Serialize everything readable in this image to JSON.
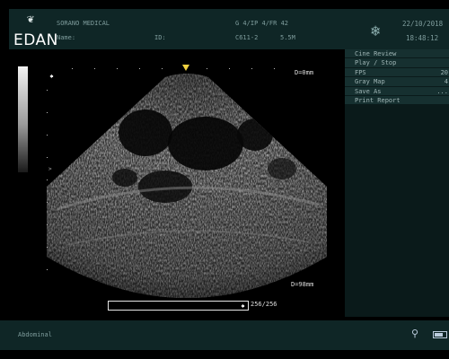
{
  "header": {
    "logo_text": "EDAN",
    "hospital": "SORANO MEDICAL",
    "name_label": "Name:",
    "id_label": "ID:",
    "params_line1": "G  4/IP 4/FR 42",
    "probe": "C611-2",
    "frequency": "5.5M",
    "date": "22/10/2018",
    "time": "18:48:12",
    "freeze_icon": "snowflake-icon"
  },
  "menu": {
    "items": [
      {
        "label": "Cine Review",
        "value": ""
      },
      {
        "label": "Play / Stop",
        "value": ""
      },
      {
        "label": "FPS",
        "value": "20"
      },
      {
        "label": "Gray Map",
        "value": "4"
      },
      {
        "label": "Save As",
        "value": "..."
      },
      {
        "label": "Print Report",
        "value": ""
      }
    ]
  },
  "image": {
    "depth_top": "D=0mm",
    "depth_bottom": "D=98mm",
    "cine_counter": "256/256",
    "cine_progress": 1.0
  },
  "footer": {
    "exam_mode": "Abdominal",
    "icons": [
      "probe-icon",
      "battery-icon"
    ]
  },
  "colors": {
    "panel": "#0f2626",
    "menu_item": "#163030",
    "focus_marker": "#f0d040"
  }
}
